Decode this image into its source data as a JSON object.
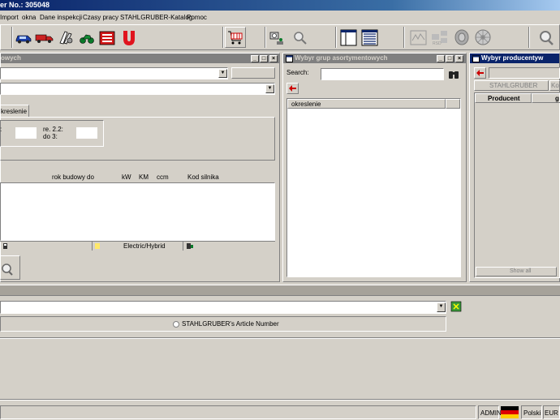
{
  "app": {
    "title": "er No.: 305048"
  },
  "menu": {
    "items": [
      "Import",
      "okna",
      "Dane inspekcji",
      "Czasy pracy",
      "STAHLGRUBER-Katalog",
      "Pomoc"
    ]
  },
  "toolbar": {
    "icons": [
      "car-icon",
      "truck-icon",
      "engine-parts-icon",
      "motorcycle-icon",
      "catalog-book-icon",
      "magnet-icon",
      "shopping-cart-icon",
      "parts-search-icon",
      "search-tool-icon",
      "window-layout-icon",
      "grid-layout-icon",
      "oscilloscope-icon",
      "data-icon",
      "tire-icon",
      "disc-icon",
      "magnifier-icon"
    ]
  },
  "vehicle_panel": {
    "title": "owych",
    "tab_label": "kreslenie",
    "label_colon": ":",
    "label_re": "re. 2.2:",
    "label_do3": "do 3:",
    "columns": [
      "rok budowy",
      "do",
      "kW",
      "KM",
      "ccm",
      "Kod silnika"
    ],
    "status_segments": [
      "Electric/Hybrid"
    ]
  },
  "groups_panel": {
    "title": "Wybyr grup asortymentowych",
    "search_label": "Search:",
    "search_value": "",
    "column_header": "okreslenie"
  },
  "producers_panel": {
    "title": "Wybyr producentyw",
    "button_label": "STAHLGRUBER",
    "button2_label": "Kod",
    "columns": [
      "Producent",
      "g"
    ],
    "show_all_label": "Show all"
  },
  "article_area": {
    "radio_label": "STAHLGRUBER's Article Number"
  },
  "statusbar": {
    "user": "ADMIN",
    "language": "Polski",
    "currency": "EUR (D"
  },
  "colors": {
    "titlebar": "#0a246a",
    "background": "#d4d0c8",
    "arrow_red": "#cc0000"
  }
}
